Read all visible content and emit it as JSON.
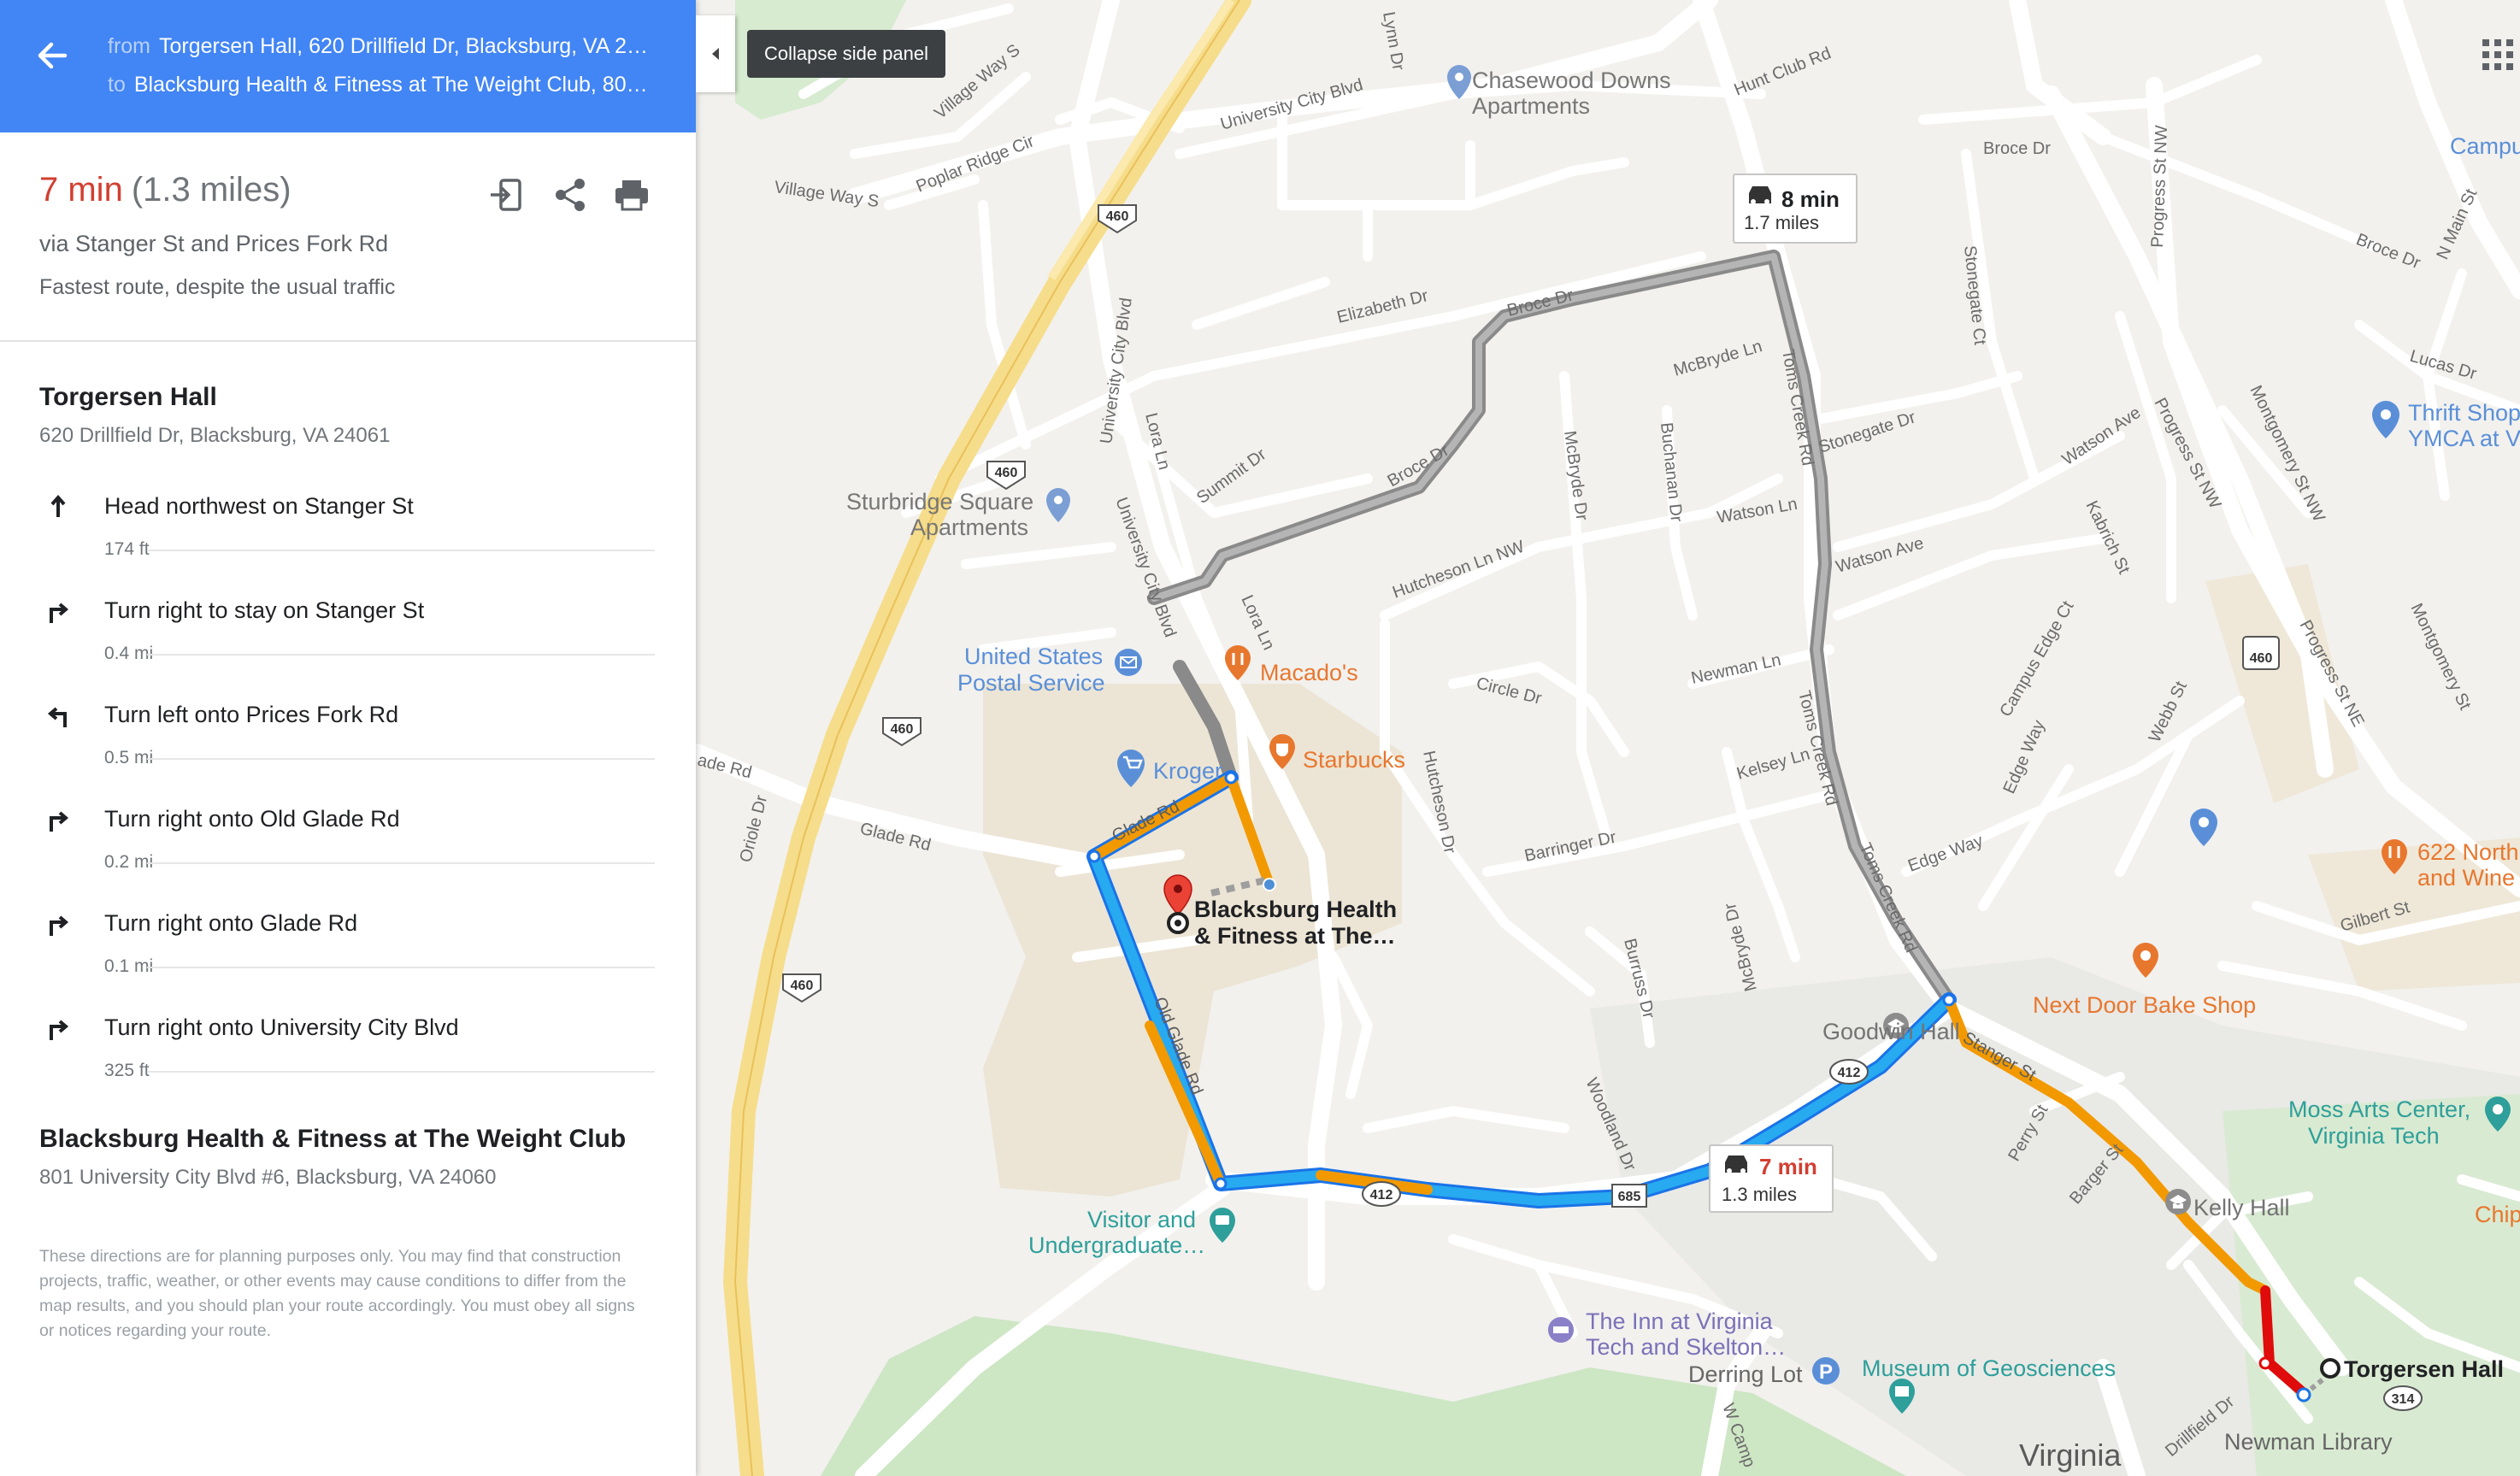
{
  "header": {
    "from_label": "from",
    "from_value": "Torgersen Hall, 620 Drillfield Dr, Blacksburg, VA 24061",
    "to_label": "to",
    "to_value": "Blacksburg Health & Fitness at The Weight Club, 801 University City Blvd #6, Blacksburg, VA 24060"
  },
  "summary": {
    "time": "7 min",
    "distance": "(1.3 miles)",
    "via": "via Stanger St and Prices Fork Rd",
    "note": "Fastest route, despite the usual traffic"
  },
  "actions": [
    "send-to-phone-icon",
    "share-icon",
    "print-icon"
  ],
  "origin": {
    "name": "Torgersen Hall",
    "address": "620 Drillfield Dr, Blacksburg, VA 24061"
  },
  "steps": [
    {
      "icon": "arrow-up-icon",
      "text": "Head northwest on Stanger St",
      "distance": "174 ft"
    },
    {
      "icon": "turn-right-icon",
      "text": "Turn right to stay on Stanger St",
      "distance": "0.4 mi"
    },
    {
      "icon": "turn-left-icon",
      "text": "Turn left onto Prices Fork Rd",
      "distance": "0.5 mi"
    },
    {
      "icon": "turn-right-icon",
      "text": "Turn right onto Old Glade Rd",
      "distance": "0.2 mi"
    },
    {
      "icon": "turn-right-icon",
      "text": "Turn right onto Glade Rd",
      "distance": "0.1 mi"
    },
    {
      "icon": "turn-right-icon",
      "text": "Turn right onto University City Blvd",
      "distance": "325 ft"
    }
  ],
  "destination": {
    "name": "Blacksburg Health & Fitness at The Weight Club",
    "address": "801 University City Blvd #6, Blacksburg, VA 24060"
  },
  "disclaimer": "These directions are for planning purposes only. You may find that construction projects, traffic, weather, or other events may cause conditions to differ from the map results, and you should plan your route accordingly. You must obey all signs or notices regarding your route.",
  "collapse_tooltip": "Collapse side panel",
  "map": {
    "route_main": {
      "time": "7 min",
      "distance": "1.3 miles"
    },
    "route_alt": {
      "time": "8 min",
      "distance": "1.7 miles"
    },
    "streets": {
      "univ_city_1": "University City Blvd",
      "univ_city_2": "University City Blvd",
      "univ_city_3": "University City Blvd",
      "village_way_s1": "Village Way S",
      "village_way_s2": "Village Way S",
      "poplar_ridge": "Poplar Ridge Cir",
      "lynn": "Lynn Dr",
      "hunt_club": "Hunt Club Rd",
      "broce1": "Broce Dr",
      "broce2": "Broce Dr",
      "broce3": "Broce Dr",
      "broce4": "Broce Dr",
      "elizabeth": "Elizabeth Dr",
      "summit": "Summit Dr",
      "lora1": "Lora Ln",
      "lora2": "Lora Ln",
      "mcbryde_ln": "McBryde Ln",
      "mcbryde_dr1": "McBryde Dr",
      "mcbryde_dr2": "McBryde Dr",
      "buchanan": "Buchanan Dr",
      "toms_creek1": "Toms Creek Rd",
      "toms_creek2": "Toms Creek Rd",
      "toms_creek3": "Toms Creek Rd",
      "stonegate_dr": "Stonegate Dr",
      "stonegate_ct": "Stonegate Ct",
      "progress1": "Progress St NW",
      "progress2": "Progress St NW",
      "progress_ne": "Progress St NE",
      "watson_ln": "Watson Ln",
      "watson_ave1": "Watson Ave",
      "watson_ave2": "Watson Ave",
      "hutcheson_ln": "Hutcheson Ln NW",
      "hutcheson_dr": "Hutcheson Dr",
      "circle": "Circle Dr",
      "newman": "Newman Ln",
      "kelsey": "Kelsey Ln",
      "barringer": "Barringer Dr",
      "burruss": "Burruss Dr",
      "woodland": "Woodland Dr",
      "glade1": "Glade Rd",
      "glade2": "Glade Rd",
      "glade3": "ade Rd",
      "old_glade": "Old Glade Rd",
      "oriole": "Oriole Dr",
      "stanger": "Stanger St",
      "perry": "Perry St",
      "barger": "Barger St",
      "campus_edge": "Campus Edge Ct",
      "edge_way1": "Edge Way",
      "edge_way2": "Edge Way",
      "webb": "Webb St",
      "kabrich": "Kabrich St",
      "montgomery1": "Montgomery St NW",
      "montgomery2": "Montgomery St",
      "lucas": "Lucas Dr",
      "n_main": "N Main St",
      "gilbert": "Gilbert St",
      "drillfield": "Drillfield Dr",
      "w_camp": "W Camp",
      "broce5": "Broce Dr"
    },
    "shields": {
      "s460a": "460",
      "s460b": "460",
      "s460c": "460",
      "s460d": "460",
      "s460bus": "460",
      "s412a": "412",
      "s412b": "412",
      "s685": "685",
      "s314": "314"
    },
    "pois": {
      "chasewood1": "Chasewood Downs",
      "chasewood2": "Apartments",
      "sturbridge1": "Sturbridge Square",
      "sturbridge2": "Apartments",
      "usps1": "United States",
      "usps2": "Postal Service",
      "macados": "Macado's",
      "starbucks": "Starbucks",
      "kroger": "Kroger",
      "dest1": "Blacksburg Health",
      "dest2": "& Fitness at The…",
      "goodwin": "Goodwin Hall",
      "nextdoor": "Next Door Bake Shop",
      "moss1": "Moss Arts Center,",
      "moss2": "Virginia Tech",
      "kelly": "Kelly Hall",
      "visitor1": "Visitor and",
      "visitor2": "Undergraduate…",
      "inn1": "The Inn at Virginia",
      "inn2": "Tech and Skelton…",
      "derring": "Derring Lot",
      "museum": "Museum of Geosciences",
      "torgersen": "Torgersen Hall",
      "newman_lib": "Newman Library",
      "virginia": "Virginia",
      "campus": "Campu",
      "thrift1": "Thrift Shop",
      "thrift2": "YMCA at V",
      "north622a": "622 North",
      "north622b": "and Wine",
      "chip": "Chip"
    }
  }
}
